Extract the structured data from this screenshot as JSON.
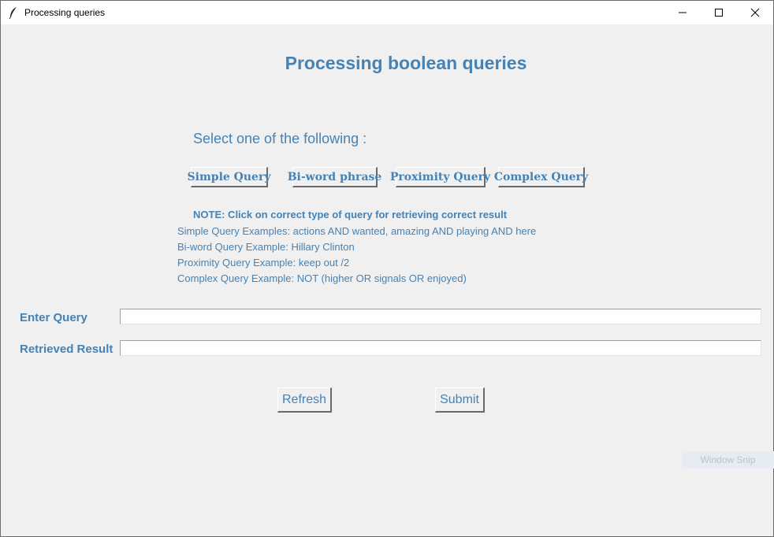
{
  "window": {
    "title": "Processing queries",
    "icon": "feather-icon",
    "controls": [
      "minimize-icon",
      "maximize-icon",
      "close-icon"
    ]
  },
  "heading": "Processing boolean queries",
  "select_label": "Select one of the following :",
  "query_buttons": {
    "simple": "Simple Query",
    "biword": "Bi-word phrase",
    "proximity": "Proximity Query",
    "complex": "Complex Query"
  },
  "note": "NOTE: Click on correct type of query for retrieving correct result",
  "examples": [
    "Simple Query Examples: actions AND wanted, amazing AND playing AND here",
    "Bi-word Query Example: Hillary Clinton",
    "Proximity Query Example: keep out /2",
    "Complex Query Example: NOT (higher OR signals OR enjoyed)"
  ],
  "fields": {
    "query_label": "Enter Query",
    "query_value": "",
    "result_label": "Retrieved Result",
    "result_value": ""
  },
  "actions": {
    "refresh": "Refresh",
    "submit": "Submit"
  },
  "overlay": "Window Snip",
  "colors": {
    "accent": "#4682b4",
    "background": "#f0f0f0"
  }
}
